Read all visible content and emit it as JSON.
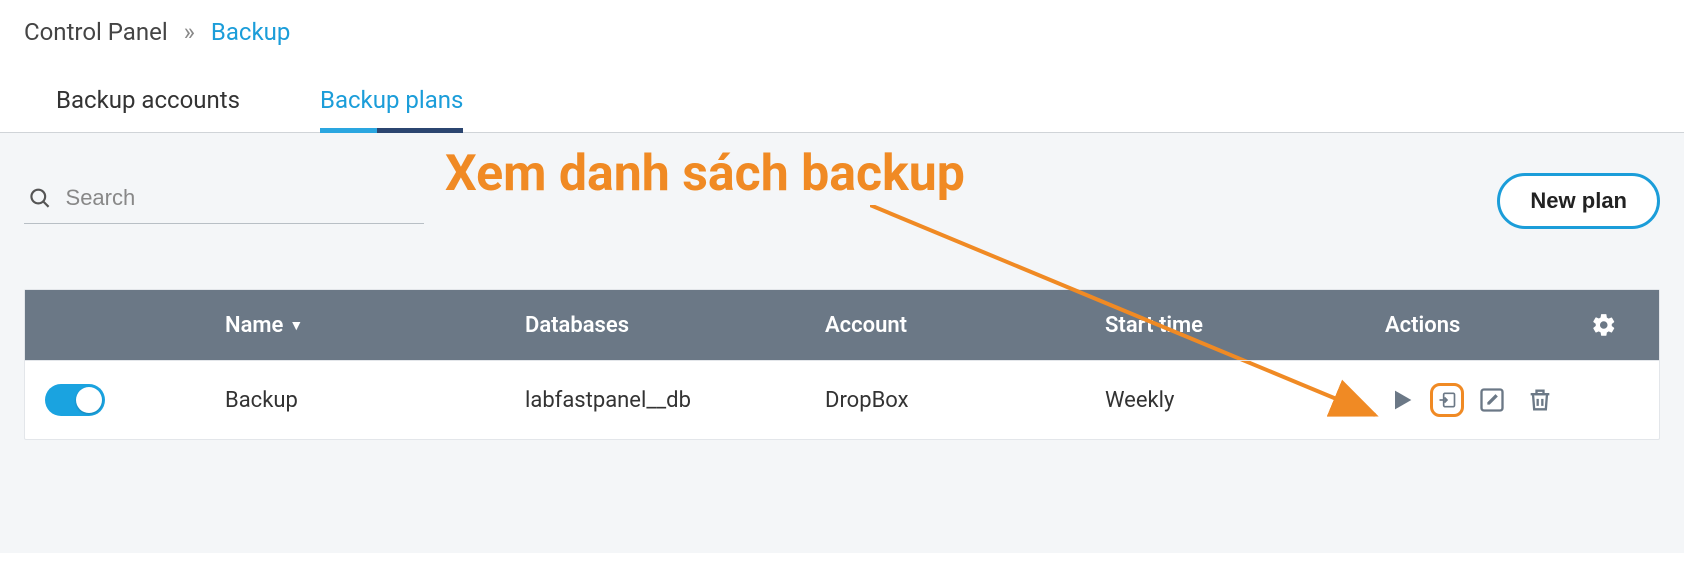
{
  "breadcrumb": {
    "root": "Control Panel",
    "separator": "»",
    "current": "Backup"
  },
  "tabs": {
    "accounts": "Backup accounts",
    "plans": "Backup plans"
  },
  "search": {
    "placeholder": "Search"
  },
  "toolbar": {
    "new_plan": "New plan"
  },
  "annotation": {
    "text": "Xem danh sách backup"
  },
  "table": {
    "columns": {
      "name": "Name",
      "databases": "Databases",
      "account": "Account",
      "start_time": "Start time",
      "actions": "Actions"
    },
    "rows": [
      {
        "enabled": true,
        "name": "Backup",
        "databases": "labfastpanel__db",
        "account": "DropBox",
        "start_time": "Weekly"
      }
    ]
  }
}
